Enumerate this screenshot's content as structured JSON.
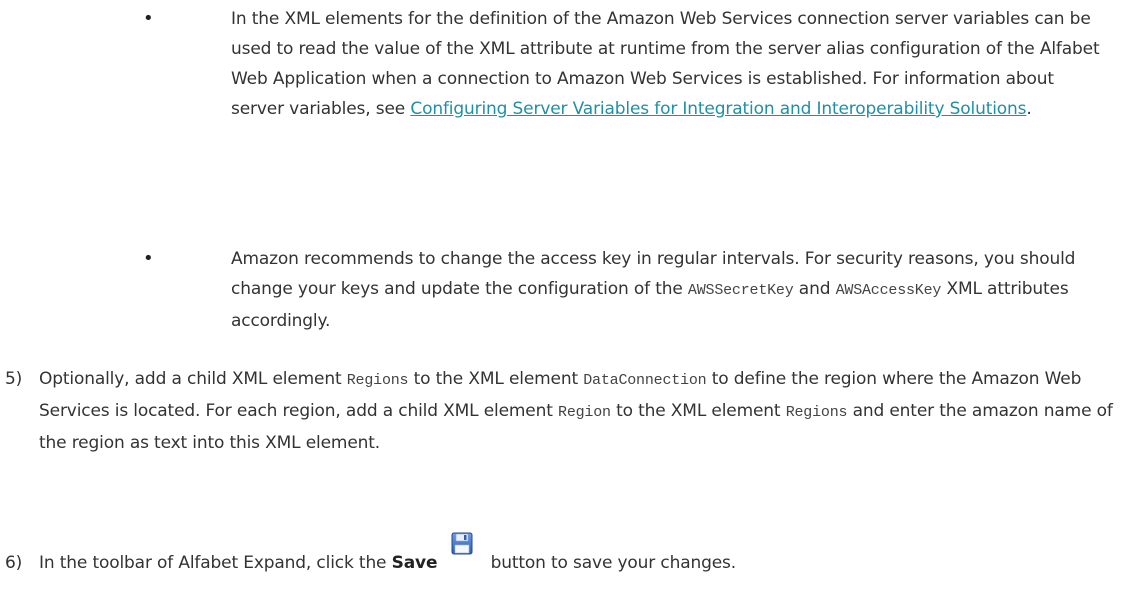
{
  "bullets": [
    {
      "symbol": "•",
      "text_part1": "In the XML elements for the definition of the Amazon Web Services connection server variables can be used to read the value of the XML attribute at runtime from the server alias configuration of the Alfabet Web Application when a connection to Amazon Web Services is established. For information about server variables, see ",
      "link_text": "Configuring Server Variables for Integration and Interoperability Solutions",
      "text_part2": "."
    },
    {
      "symbol": "•",
      "text_part1": "Amazon recommends to change the access key in regular intervals. For security reasons, you should change your keys and update the configuration of the ",
      "code1": "AWSSecretKey",
      "text_and": " and ",
      "code2": "AWSAccessKey",
      "text_part2": " XML attributes accordingly."
    }
  ],
  "steps": [
    {
      "number": "5)",
      "t1": "Optionally, add a child XML element ",
      "c1": "Regions",
      "t2": " to the XML element ",
      "c2": "DataConnection",
      "t3": " to define the region where the Amazon Web Services is located. For each region, add a child XML element ",
      "c3": "Region",
      "t4": " to the XML element ",
      "c4": "Regions",
      "t5": " and enter the amazon name of the region as text into this XML element."
    },
    {
      "number": "6)",
      "t1": "In the toolbar of Alfabet Expand, click the ",
      "bold": "Save",
      "icon": "save-floppy-icon",
      "t2": " button to save your changes."
    }
  ],
  "colors": {
    "text": "#333333",
    "link": "#1f8fa6",
    "icon_blue": "#3b6fc4"
  }
}
